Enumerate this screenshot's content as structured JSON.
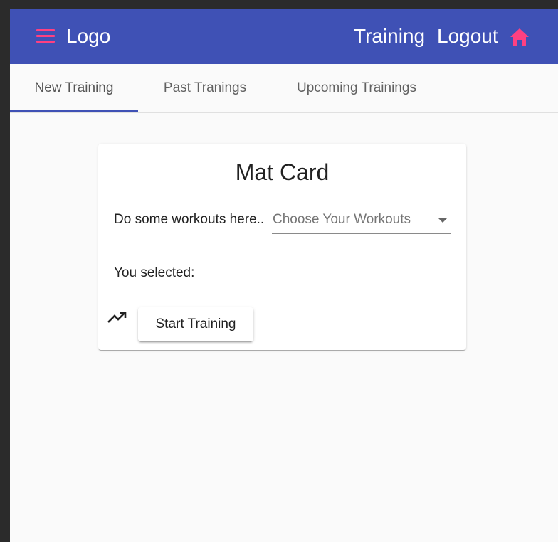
{
  "toolbar": {
    "logo": "Logo",
    "nav_training": "Training",
    "nav_logout": "Logout"
  },
  "tabs": [
    {
      "label": "New Training",
      "active": true
    },
    {
      "label": "Past Tranings",
      "active": false
    },
    {
      "label": "Upcoming Trainings",
      "active": false
    }
  ],
  "card": {
    "title": "Mat Card",
    "prompt": "Do some workouts here..",
    "select_placeholder": "Choose Your Workouts",
    "selected_label": "You selected:",
    "start_button": "Start Training"
  },
  "icons": {
    "menu": "menu-icon",
    "home": "home-icon",
    "trend": "trending-up-icon"
  },
  "colors": {
    "primary": "#3f51b5",
    "accent": "#ff4081"
  }
}
